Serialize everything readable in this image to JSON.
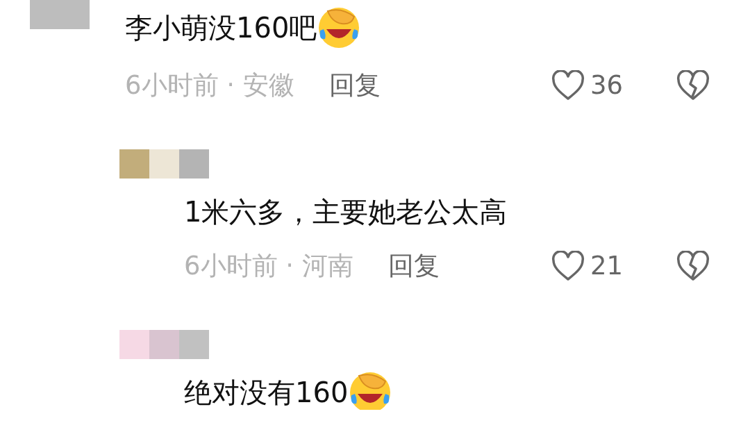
{
  "comments": [
    {
      "kind": "top",
      "mosaic": [
        {
          "color": "#bdbdbd"
        },
        {
          "color": "#bdbdbd"
        }
      ],
      "text": "李小萌没160吧",
      "emoji": true,
      "meta": {
        "time": "6小时前",
        "separator": "·",
        "location": "安徽",
        "reply": "回复",
        "likes": "36"
      }
    },
    {
      "kind": "reply",
      "mosaic": [
        {
          "color": "#c2ad7b"
        },
        {
          "color": "#ede6d6"
        },
        {
          "color": "#b4b4b4"
        }
      ],
      "text": "1米六多，主要她老公太高",
      "emoji": false,
      "meta": {
        "time": "6小时前",
        "separator": "·",
        "location": "河南",
        "reply": "回复",
        "likes": "21"
      }
    },
    {
      "kind": "reply",
      "mosaic": [
        {
          "color": "#f6d9e5"
        },
        {
          "color": "#d9c4d0"
        },
        {
          "color": "#c1c1c1"
        }
      ],
      "text": "绝对没有160",
      "emoji": true
    }
  ]
}
